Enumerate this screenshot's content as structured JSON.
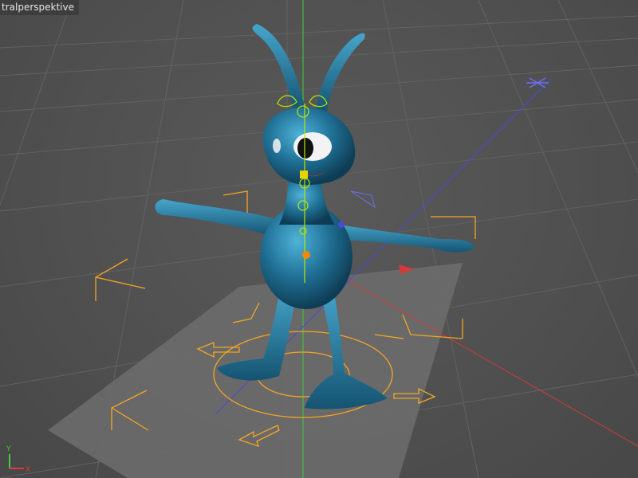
{
  "viewport": {
    "label": "tralperspektive",
    "background": "#545454",
    "grid_color": "#606060",
    "floor_color": "#6a6a6a",
    "character_color": "#1f6f94",
    "selection_color": "#f5a623",
    "bone_color": "#b8e600"
  },
  "axis_gizmo": {
    "y_label": "Y",
    "x_label": "X",
    "y_color": "#3ccf3c",
    "x_color": "#e33a3a"
  },
  "icons": [
    "axis-gizmo-icon",
    "move-arrow-icon",
    "light-icon"
  ]
}
